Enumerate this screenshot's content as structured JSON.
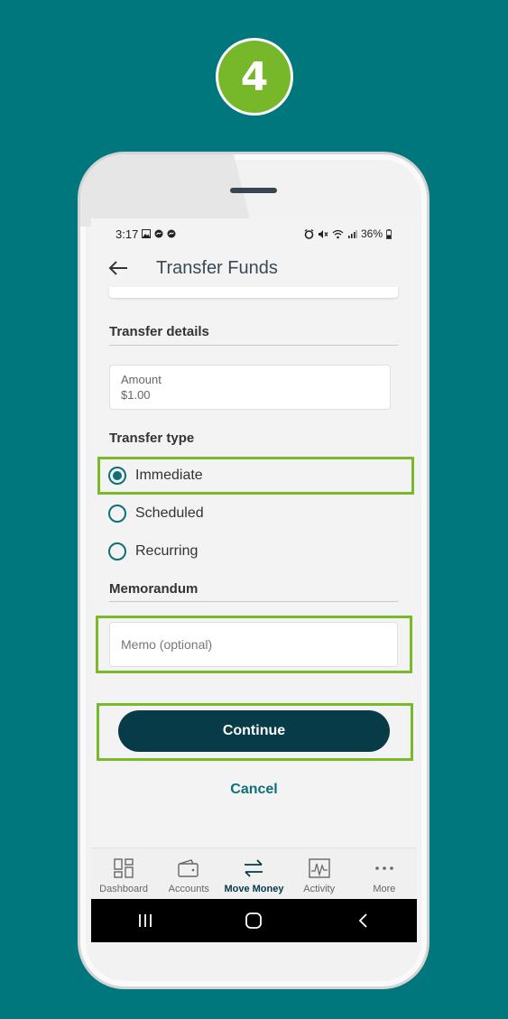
{
  "step": {
    "number": "4"
  },
  "status_bar": {
    "time": "3:17",
    "battery": "36%"
  },
  "app_bar": {
    "title": "Transfer Funds"
  },
  "transfer_details": {
    "heading": "Transfer details",
    "amount_label": "Amount",
    "amount_value": "$1.00"
  },
  "transfer_type": {
    "heading": "Transfer type",
    "options": [
      {
        "label": "Immediate",
        "selected": true
      },
      {
        "label": "Scheduled",
        "selected": false
      },
      {
        "label": "Recurring",
        "selected": false
      }
    ]
  },
  "memorandum": {
    "heading": "Memorandum",
    "placeholder": "Memo (optional)"
  },
  "actions": {
    "continue_label": "Continue",
    "cancel_label": "Cancel"
  },
  "bottom_nav": {
    "items": [
      {
        "label": "Dashboard",
        "icon": "dashboard-icon"
      },
      {
        "label": "Accounts",
        "icon": "wallet-icon"
      },
      {
        "label": "Move Money",
        "icon": "transfer-arrows-icon",
        "active": true
      },
      {
        "label": "Activity",
        "icon": "activity-chart-icon"
      },
      {
        "label": "More",
        "icon": "more-dots-icon"
      }
    ]
  },
  "colors": {
    "background": "#00767d",
    "highlight": "#7ab929",
    "badge": "#76b82a",
    "primary_button": "#063b47",
    "accent": "#0f6f77"
  }
}
